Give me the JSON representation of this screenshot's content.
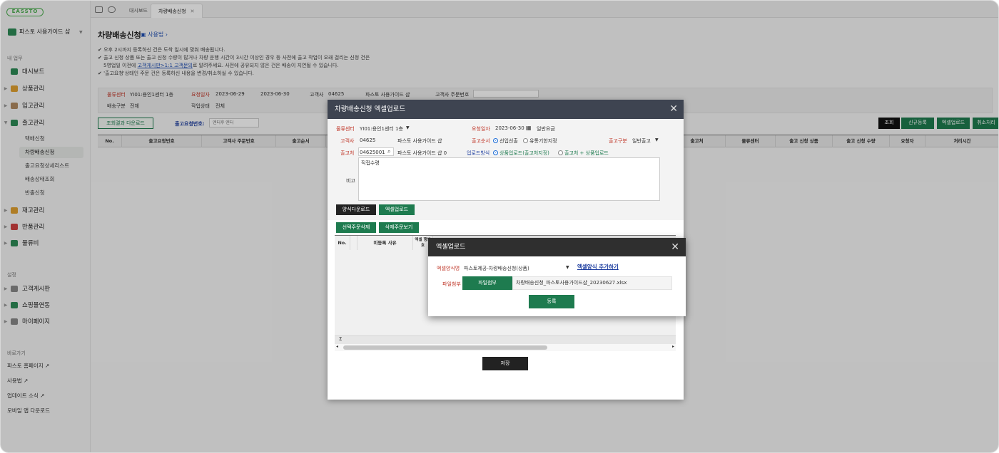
{
  "brand": {
    "logo": "EASSTO"
  },
  "sidebar": {
    "shop_name": "파스토 사용가이드 샵",
    "section_my_work": "내 업무",
    "menu": [
      {
        "label": "대시보드",
        "icon": "chart-icon",
        "color": "#2e8b57"
      },
      {
        "label": "상품관리",
        "icon": "box-icon",
        "color": "#e0a030"
      },
      {
        "label": "입고관리",
        "icon": "inbound-icon",
        "color": "#b08a60"
      },
      {
        "label": "출고관리",
        "icon": "truck-icon",
        "color": "#2e8b57"
      },
      {
        "label": "재고관리",
        "icon": "stock-icon",
        "color": "#e0a030"
      },
      {
        "label": "반품관리",
        "icon": "return-icon",
        "color": "#d04040"
      },
      {
        "label": "물류비",
        "icon": "fee-icon",
        "color": "#2e8b57"
      }
    ],
    "outbound_sub": [
      "택배신청",
      "차량배송신청",
      "출고요청상세리스트",
      "배송상태조회",
      "반출신청"
    ],
    "section_settings": "설정",
    "settings": [
      {
        "label": "고객게시판",
        "icon": "board-icon"
      },
      {
        "label": "쇼핑몰연동",
        "icon": "link-icon"
      },
      {
        "label": "마이페이지",
        "icon": "user-icon"
      }
    ],
    "section_shortcuts": "바로가기",
    "shortcuts": [
      "파스토 홈페이지",
      "사용법",
      "업데이트 소식",
      "모바일 앱 다운로드"
    ]
  },
  "tabs": {
    "dashboard": "대시보드",
    "current": "차량배송신청"
  },
  "page": {
    "title": "차량배송신청",
    "usage": "사용법",
    "notes": [
      "오후 2시까지 등록하신 건은 도착 일시에 맞춰 배송됩니다.",
      "출고 신청 상품 또는 출고 신청 수량이 많거나 차량 운행 시간이 3시간 이상인 경우 등 사전에 출고 작업이 오래 걸리는 신청 건은",
      "5영업일 이전에",
      "고객게시판>1:1 고객문의",
      "로 알려주세요. 사전에 공유되지 않은 건은 배송이 지연될 수 있습니다.",
      "'출고요청'상태인 주문 건은 등록하신 내용을 변경/취소하실 수 있습니다."
    ],
    "filters": {
      "center_label": "물류센터",
      "center_value": "YI01:용인1센터 1층",
      "date_label": "요청일자",
      "date_from": "2023-06-29",
      "date_to": "2023-06-30",
      "client_label": "고객사",
      "client_code": "04625",
      "client_name": "파스토 사용가이드 샵",
      "client_order_label": "고객사 주문번호",
      "ship_type_label": "배송구분",
      "ship_type_value": "전체",
      "work_status_label": "작업상태",
      "work_status_value": "전체"
    },
    "toolbar": {
      "download_result": "조회결과 다운로드",
      "out_req_label": "출고요청번호:",
      "out_req_placeholder": "엔터후 엔터",
      "search": "조회",
      "new": "신규등록",
      "excel_upload": "엑셀업로드",
      "cancel": "취소처리"
    },
    "grid_headers": [
      "No.",
      "출고요청번호",
      "고객사 주문번호",
      "출고순서",
      "출고처",
      "물류센터",
      "출고 신청 상품",
      "출고 신청 수량",
      "요청자",
      "처리시간"
    ]
  },
  "modal_upload": {
    "title": "차량배송신청 엑셀업로드",
    "center_label": "물류센터",
    "center_value": "YI01:용인1센터 1층",
    "date_label": "요청일자",
    "date_value": "2023-06-30",
    "date_type": "일반요금",
    "client_label": "고객사",
    "client_code": "04625",
    "client_name": "파스토 사용가이드 샵",
    "order_label": "출고순서",
    "order_opt1": "선입선출",
    "order_opt2": "유통기한지정",
    "out_type_label": "출고구분",
    "out_type_value": "일반출고",
    "dest_label": "출고처",
    "dest_code": "04625001",
    "dest_name": "파스토 사용가이드 샵 0",
    "method_label": "업로드방식",
    "method_opt1": "상품업로드(출고처지정)",
    "method_opt2": "출고처 + 상품업로드",
    "memo_label": "비고",
    "memo_value": "직접수령",
    "btn_template": "양식다운로드",
    "btn_excel": "엑셀업로드",
    "btn_delete_selected": "선택주문삭제",
    "btn_view_deleted": "삭제주문보기",
    "grid_no": "No.",
    "grid_reason": "미등록 사유",
    "grid_excel_row": "엑셀 행번호",
    "save": "저장"
  },
  "modal_excel": {
    "title": "엑셀업로드",
    "form_label": "엑셀양식명",
    "form_value": "파스토제공-차량배송신청(상품)",
    "add_form": "엑셀양식 추가하기",
    "file_label": "파일첨부",
    "file_button": "파일첨부",
    "file_name": "차량배송신청_파스토사용가이드샵_20230627.xlsx",
    "submit": "등록"
  }
}
